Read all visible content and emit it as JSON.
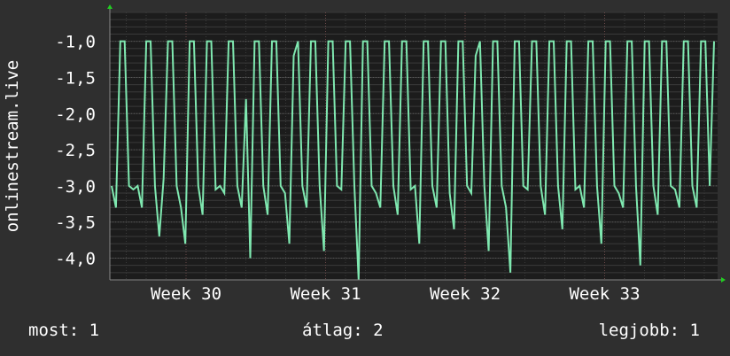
{
  "chart_data": {
    "type": "line",
    "ylabel": "onlinestream.live",
    "ylim": [
      -4.3,
      -0.6
    ],
    "y_ticks": [
      -1.0,
      -1.5,
      -2.0,
      -2.5,
      -3.0,
      -3.5,
      -4.0
    ],
    "y_tick_labels": [
      "-1,0",
      "-1,5",
      "-2,0",
      "-2,5",
      "-3,0",
      "-3,5",
      "-4,0"
    ],
    "x_tick_labels": [
      "Week 30",
      "Week 31",
      "Week 32",
      "Week 33"
    ],
    "grid": true,
    "series": [
      {
        "values": [
          -3.0,
          -3.3,
          -1.0,
          -1.0,
          -3.0,
          -3.05,
          -3.0,
          -3.3,
          -1.0,
          -1.0,
          -3.0,
          -3.7,
          -2.9,
          -1.0,
          -1.0,
          -3.0,
          -3.3,
          -3.8,
          -1.0,
          -1.0,
          -3.0,
          -3.4,
          -1.0,
          -1.0,
          -3.05,
          -3.0,
          -3.1,
          -1.0,
          -1.0,
          -3.0,
          -3.3,
          -1.8,
          -4.0,
          -1.0,
          -1.0,
          -3.0,
          -3.4,
          -1.0,
          -1.0,
          -3.0,
          -3.1,
          -3.8,
          -1.2,
          -1.0,
          -3.0,
          -3.3,
          -1.0,
          -1.0,
          -3.0,
          -3.9,
          -1.0,
          -1.0,
          -3.0,
          -3.05,
          -1.0,
          -1.0,
          -3.0,
          -4.3,
          -1.0,
          -1.0,
          -3.0,
          -3.1,
          -3.3,
          -1.0,
          -1.0,
          -3.0,
          -3.4,
          -1.0,
          -1.0,
          -3.05,
          -3.0,
          -3.8,
          -1.0,
          -1.0,
          -3.0,
          -3.3,
          -1.0,
          -1.0,
          -3.1,
          -3.6,
          -1.0,
          -1.0,
          -3.0,
          -3.1,
          -1.2,
          -1.0,
          -3.0,
          -3.9,
          -1.0,
          -1.0,
          -3.0,
          -3.3,
          -4.2,
          -1.0,
          -1.0,
          -3.0,
          -3.05,
          -1.0,
          -1.0,
          -3.0,
          -3.4,
          -1.0,
          -1.0,
          -3.0,
          -3.6,
          -1.0,
          -1.0,
          -3.05,
          -3.0,
          -3.3,
          -1.0,
          -1.0,
          -3.0,
          -3.8,
          -1.0,
          -1.0,
          -3.0,
          -3.1,
          -3.3,
          -1.0,
          -1.0,
          -3.0,
          -4.1,
          -1.0,
          -1.0,
          -3.0,
          -3.4,
          -1.0,
          -1.0,
          -3.0,
          -3.05,
          -3.3,
          -1.0,
          -1.0,
          -3.0,
          -3.3,
          -1.0,
          -1.0,
          -3.0,
          -1.0
        ]
      }
    ]
  },
  "footer": {
    "current": "most: 1",
    "average": "átlag: 2",
    "best": "legjobb: 1"
  },
  "colors": {
    "background": "#2f2f2f",
    "plot_background": "#1c1c1c",
    "line": "#7fe8b0",
    "axis_arrow": "#22cc22",
    "grid": "#555555",
    "grid_minor": "#3a3a3a"
  }
}
